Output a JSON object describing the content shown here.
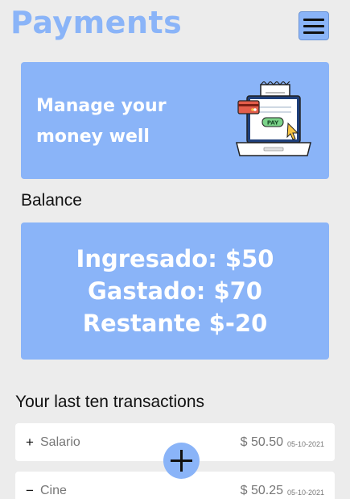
{
  "header": {
    "title": "Payments",
    "menu_icon": "hamburger-menu-icon"
  },
  "hero": {
    "text": "Manage your money well",
    "illustration_icon": "laptop-payment-icon",
    "illustration_label": "PAY"
  },
  "balance": {
    "heading": "Balance",
    "ingresado": "Ingresado: $50",
    "gastado": "Gastado: $70",
    "restante": "Restante $-20"
  },
  "transactions": {
    "heading": "Your last ten transactions",
    "items": [
      {
        "sign": "+",
        "name": "Salario",
        "amount": "$ 50.50",
        "date": "05-10-2021"
      },
      {
        "sign": "−",
        "name": "Cine",
        "amount": "$ 50.25",
        "date": "05-10-2021"
      }
    ]
  },
  "fab": {
    "icon": "plus-icon"
  },
  "colors": {
    "accent": "#8ab4f8",
    "background": "#ececec",
    "card": "#ffffff"
  }
}
